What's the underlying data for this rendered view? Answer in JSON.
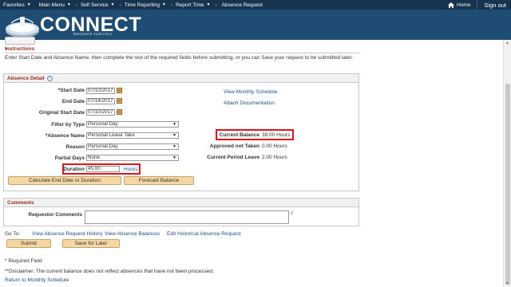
{
  "nav": {
    "favorites": "Favorites",
    "main_menu": "Main Menu",
    "crumbs": [
      "Self Service",
      "Time Reporting",
      "Report Time",
      "Absence Request"
    ],
    "home": "Home",
    "sign_out": "Sign out"
  },
  "brand": {
    "name": "CONNECT",
    "subtitle": "Maryland Judiciary"
  },
  "instructions": {
    "header": "Instructions",
    "text": "Enter Start Date and Absence Name, then complete the rest of the required fields before submitting, or you can Save your request to be submitted later."
  },
  "absence_detail": {
    "header": "Absence Detail",
    "start_date_label": "*Start Date",
    "start_date": "07/10/2017",
    "end_date_label": "End Date",
    "end_date": "07/14/2017",
    "original_start_label": "Original Start Date",
    "original_start": "07/10/2017",
    "filter_label": "Filter by Type",
    "filter_value": "Personal Day",
    "absence_name_label": "*Absence Name",
    "absence_name_value": "Personal Leave Take",
    "reason_label": "Reason",
    "reason_value": "Personal Day",
    "partial_days_label": "Partial Days",
    "partial_days_value": "None",
    "duration_label": "Duration",
    "duration_value": "45.00",
    "duration_unit": "Hours",
    "view_monthly": "View Monthly Schedule",
    "attach_doc": "Attach Documentation",
    "current_balance_label": "Current Balance",
    "current_balance_value": "39.00 Hours",
    "approved_not_taken_label": "Approved not Taken",
    "approved_not_taken_value": "0.00 Hours",
    "current_period_label": "Current Period Leave",
    "current_period_value": "2.00 Hours",
    "calc_button": "Calculate End Date or Duration",
    "forecast_button": "Forecast Balance"
  },
  "comments": {
    "header": "Comments",
    "requestor_label": "Requestor Comments"
  },
  "goto": {
    "label": "Go To:",
    "links": [
      "View Absence Request History",
      "View Absence Balances",
      "Edit Historical Absence Request"
    ]
  },
  "actions": {
    "submit": "Submit",
    "save_later": "Save for Later"
  },
  "footer": {
    "required": "* Required Field",
    "disclaimer": "**Disclaimer: The current balance does not reflect absences that have not been processed.",
    "return_link": "Return to Monthly Schedule"
  },
  "colors": {
    "nav_bg": "#17334f",
    "header_bg": "#1f4c73",
    "section_title": "#9b2c1d",
    "link": "#1f4f8f",
    "highlight": "#e0141b",
    "button_bg": "#f4d7a3"
  }
}
